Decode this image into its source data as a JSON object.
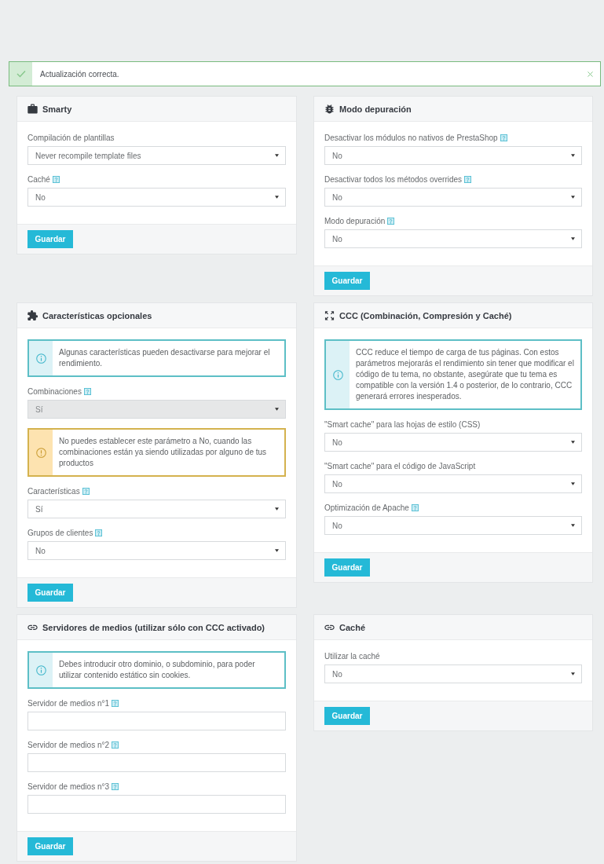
{
  "alert": {
    "kind": "success",
    "message": "Actualización correcta."
  },
  "panels": [
    {
      "title": "Smarty",
      "items": [
        {
          "kind": "select",
          "label": "Compilación de plantillas",
          "help": false,
          "value": "Never recompile template files",
          "disabled": false
        },
        {
          "kind": "select",
          "label": "Caché",
          "help": true,
          "value": "No",
          "disabled": false
        }
      ],
      "button": "Guardar"
    },
    {
      "title": "Modo depuración",
      "items": [
        {
          "kind": "select",
          "label": "Desactivar los módulos no nativos de PrestaShop",
          "help": true,
          "value": "No",
          "disabled": false
        },
        {
          "kind": "select",
          "label": "Desactivar todos los métodos overrides",
          "help": true,
          "value": "No",
          "disabled": false
        },
        {
          "kind": "select",
          "label": "Modo depuración",
          "help": true,
          "value": "No",
          "disabled": false
        }
      ],
      "button": "Guardar"
    },
    {
      "title": "Características opcionales",
      "items": [
        {
          "kind": "info",
          "text": "Algunas características pueden desactivarse para mejorar el rendimiento."
        },
        {
          "kind": "select",
          "label": "Combinaciones",
          "help": true,
          "value": "Sí",
          "disabled": true
        },
        {
          "kind": "warning",
          "text": "No puedes establecer este parámetro a No, cuando las combinaciones están ya siendo utilizadas por alguno de tus productos"
        },
        {
          "kind": "select",
          "label": "Características",
          "help": true,
          "value": "Sí",
          "disabled": false
        },
        {
          "kind": "select",
          "label": "Grupos de clientes",
          "help": true,
          "value": "No",
          "disabled": false
        }
      ],
      "button": "Guardar"
    },
    {
      "title": "CCC (Combinación, Compresión y Caché)",
      "items": [
        {
          "kind": "info",
          "text": "CCC reduce el tiempo de carga de tus páginas. Con estos parámetros mejorarás el rendimiento sin tener que modificar el código de tu tema, no obstante, asegúrate que tu tema es compatible con la versión 1.4 o posterior, de lo contrario, CCC generará errores inesperados."
        },
        {
          "kind": "select",
          "label": "\"Smart cache\" para las hojas de estilo (CSS)",
          "help": false,
          "value": "No",
          "disabled": false
        },
        {
          "kind": "select",
          "label": "\"Smart cache\" para el código de JavaScript",
          "help": false,
          "value": "No",
          "disabled": false
        },
        {
          "kind": "select",
          "label": "Optimización de Apache",
          "help": true,
          "value": "No",
          "disabled": false
        }
      ],
      "button": "Guardar"
    },
    {
      "title": "Servidores de medios (utilizar sólo con CCC activado)",
      "items": [
        {
          "kind": "info",
          "text": "Debes introducir otro dominio, o subdominio, para poder utilizar contenido estático sin cookies."
        },
        {
          "kind": "input",
          "label": "Servidor de medios n°1",
          "help": true
        },
        {
          "kind": "input",
          "label": "Servidor de medios n°2",
          "help": true
        },
        {
          "kind": "input",
          "label": "Servidor de medios n°3",
          "help": true
        }
      ],
      "button": "Guardar"
    },
    {
      "title": "Caché",
      "items": [
        {
          "kind": "select",
          "label": "Utilizar la caché",
          "help": false,
          "value": "No",
          "disabled": false
        }
      ],
      "button": "Guardar"
    }
  ]
}
